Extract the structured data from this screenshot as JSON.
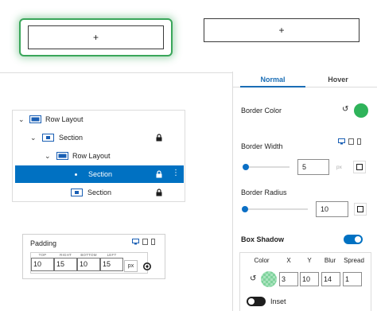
{
  "previews": {
    "selected_plus": "+",
    "other_plus": "+"
  },
  "tree": {
    "rows": [
      {
        "label": "Row Layout",
        "icon": "row-layout-icon",
        "chevron": "expanded",
        "locked": false,
        "selected": false
      },
      {
        "label": "Section",
        "icon": "section-icon",
        "chevron": "expanded",
        "locked": true,
        "selected": false
      },
      {
        "label": "Row Layout",
        "icon": "row-layout-icon",
        "chevron": "expanded",
        "locked": false,
        "selected": false
      },
      {
        "label": "Section",
        "icon": "section-icon",
        "chevron": "none",
        "locked": true,
        "selected": true
      },
      {
        "label": "Section",
        "icon": "section-icon",
        "chevron": "none",
        "locked": true,
        "selected": false
      }
    ]
  },
  "padding": {
    "title": "Padding",
    "devices": [
      "desktop-icon",
      "tablet-icon",
      "mobile-icon"
    ],
    "sides": [
      {
        "label": "TOP",
        "value": "10"
      },
      {
        "label": "RIGHT",
        "value": "15"
      },
      {
        "label": "BOTTOM",
        "value": "10"
      },
      {
        "label": "LEFT",
        "value": "15"
      }
    ],
    "unit": "px",
    "link_icon": "link-sides-icon"
  },
  "panel": {
    "tabs": {
      "normal": "Normal",
      "hover": "Hover",
      "active": "Normal"
    },
    "border_color": {
      "label": "Border Color",
      "value": "#2fb35a",
      "reset_icon": "reset-icon"
    },
    "border_width": {
      "label": "Border Width",
      "value": "5",
      "unit": "px",
      "slider_fraction": 0.05,
      "devices": [
        "desktop-icon",
        "tablet-icon",
        "mobile-icon"
      ]
    },
    "border_radius": {
      "label": "Border Radius",
      "value": "10",
      "slider_fraction": 0.02
    },
    "box_shadow": {
      "label": "Box Shadow",
      "enabled": true,
      "headers": {
        "color": "Color",
        "x": "X",
        "y": "Y",
        "blur": "Blur",
        "spread": "Spread"
      },
      "values": {
        "x": "3",
        "y": "10",
        "blur": "14",
        "spread": "1"
      },
      "color": "#7fd39c",
      "inset_label": "Inset",
      "inset_enabled": false
    }
  },
  "colors": {
    "accent": "#0071c2",
    "tab_active": "#1a6db5",
    "preview_glow": "#3aa65a"
  }
}
